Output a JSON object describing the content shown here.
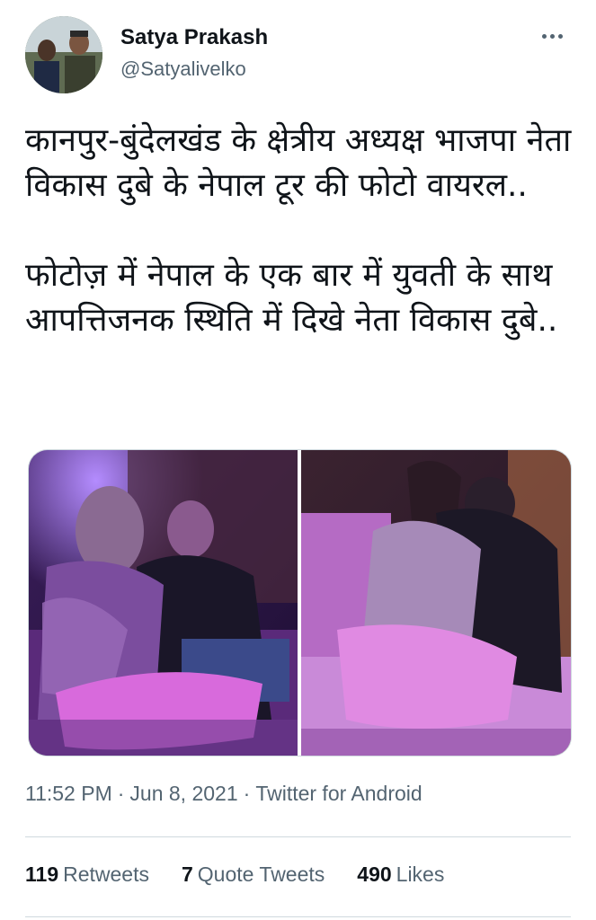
{
  "user": {
    "display_name": "Satya Prakash",
    "handle": "@Satyalivelko"
  },
  "tweet": {
    "paragraphs": [
      "कानपुर-बुंदेलखंड के क्षेत्रीय अध्यक्ष भाजपा नेता विकास दुबे के नेपाल टूर की फोटो वायरल..",
      "फोटोज़ में नेपाल के एक बार में युवती के साथ आपत्तिजनक स्थिति में दिखे नेता विकास दुबे.."
    ],
    "time": "11:52 PM",
    "date": "Jun 8, 2021",
    "source": "Twitter for Android"
  },
  "stats": {
    "retweets_count": "119",
    "retweets_label": "Retweets",
    "quote_count": "7",
    "quote_label": "Quote Tweets",
    "likes_count": "490",
    "likes_label": "Likes"
  },
  "icons": {
    "more": "more-horizontal-icon"
  },
  "colors": {
    "primary_text": "#0f1419",
    "secondary_text": "#536471",
    "divider": "#cfd9de",
    "photo_tint": "#7a2fc0"
  }
}
